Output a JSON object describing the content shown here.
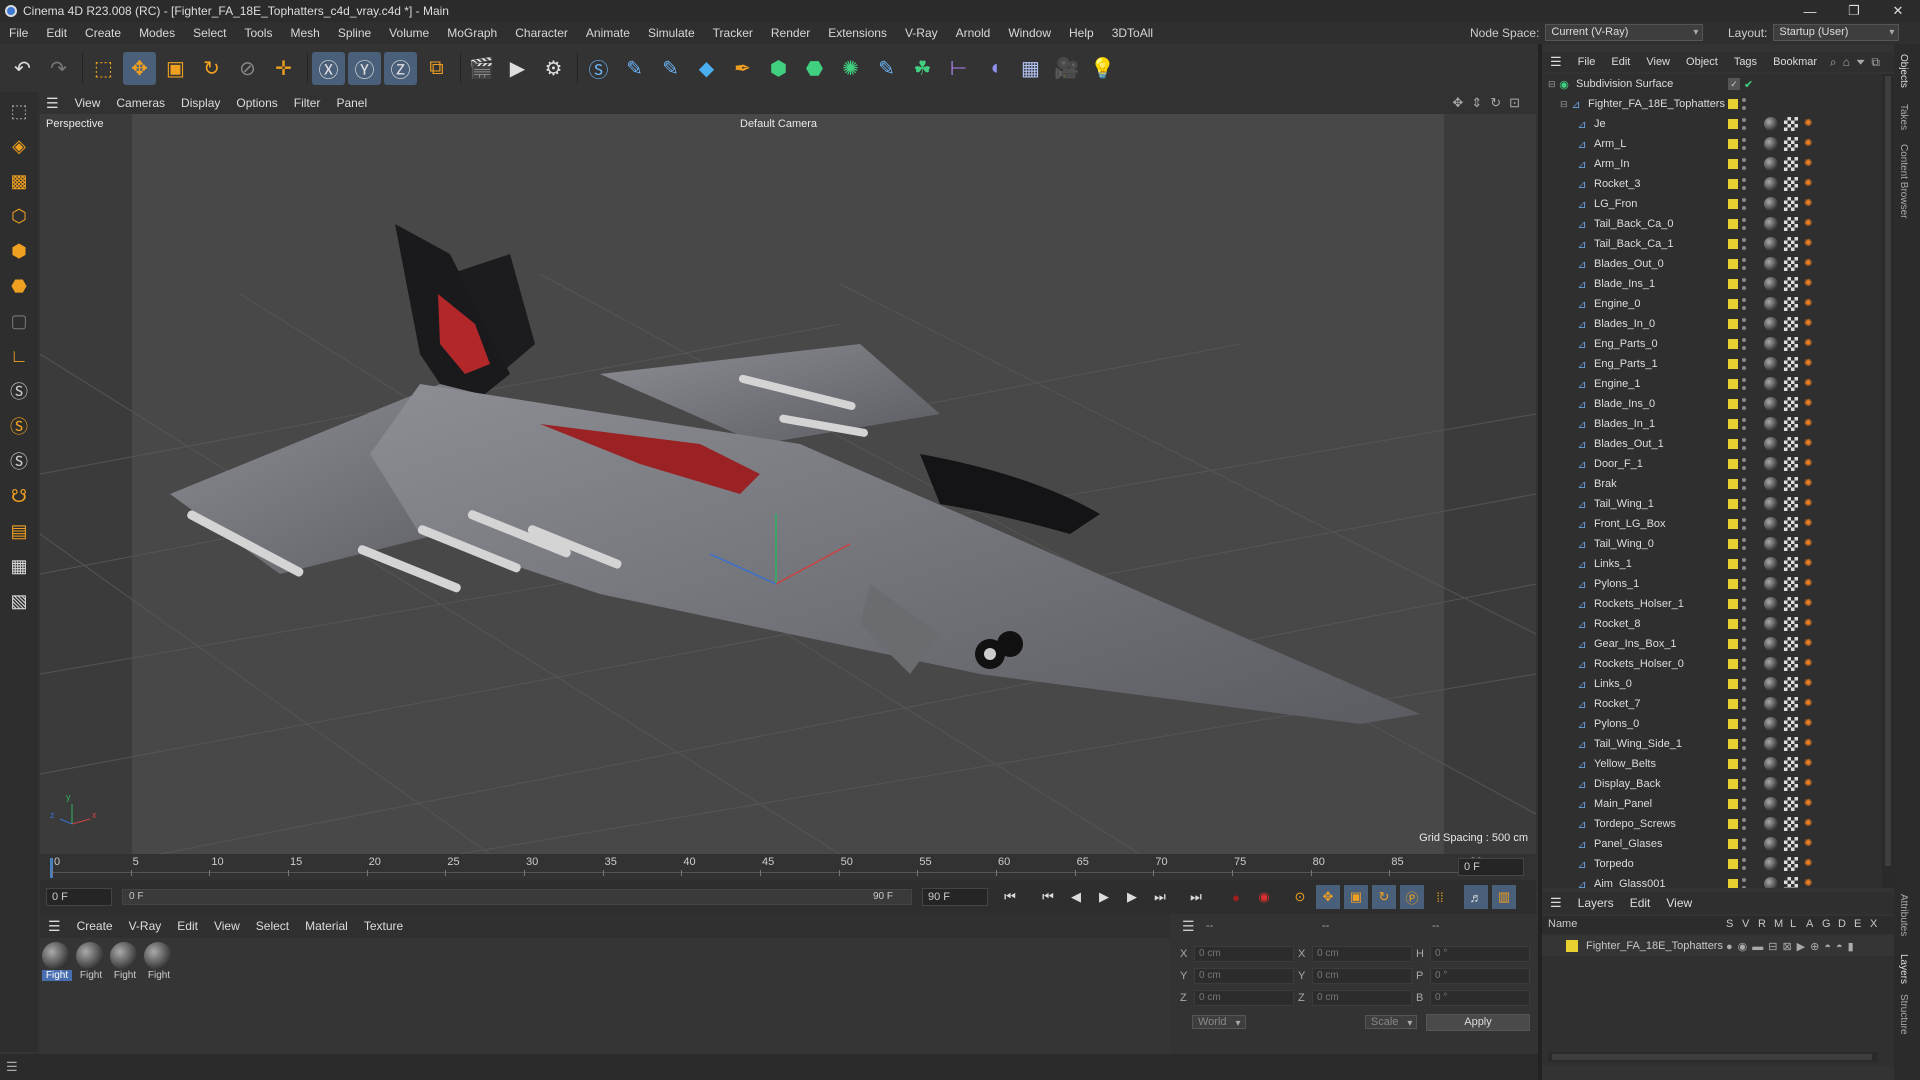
{
  "window": {
    "title": "Cinema 4D R23.008 (RC) - [Fighter_FA_18E_Tophatters_c4d_vray.c4d *] - Main",
    "controls": [
      "—",
      "❐",
      "✕"
    ]
  },
  "menubar": [
    "File",
    "Edit",
    "Create",
    "Modes",
    "Select",
    "Tools",
    "Mesh",
    "Spline",
    "Volume",
    "MoGraph",
    "Character",
    "Animate",
    "Simulate",
    "Tracker",
    "Render",
    "Extensions",
    "V-Ray",
    "Arnold",
    "Window",
    "Help",
    "3DToAll"
  ],
  "node_space": {
    "label": "Node Space:",
    "value": "Current (V-Ray)"
  },
  "layout": {
    "label": "Layout:",
    "value": "Startup (User)"
  },
  "viewport": {
    "menu": [
      "View",
      "Cameras",
      "Display",
      "Options",
      "Filter",
      "Panel"
    ],
    "view_name": "Perspective",
    "camera": "Default Camera",
    "grid_spacing": "Grid Spacing : 500 cm",
    "axis": {
      "x": "x",
      "y": "y",
      "z": "z"
    }
  },
  "timeline": {
    "ticks": [
      "0",
      "5",
      "10",
      "15",
      "20",
      "25",
      "30",
      "35",
      "40",
      "45",
      "50",
      "55",
      "60",
      "65",
      "70",
      "75",
      "80",
      "85",
      "90"
    ],
    "current": "0 F"
  },
  "time_controls": {
    "start": "0 F",
    "range_start": "0 F",
    "range_end": "90 F",
    "end": "90 F"
  },
  "material_manager": {
    "menu": [
      "Create",
      "V-Ray",
      "Edit",
      "View",
      "Select",
      "Material",
      "Texture"
    ],
    "materials": [
      "Fight",
      "Fight",
      "Fight",
      "Fight"
    ]
  },
  "coordinates": {
    "header": "--",
    "header2": "--",
    "header3": "--",
    "rows": [
      {
        "a": "X",
        "av": "0 cm",
        "b": "X",
        "bv": "0 cm",
        "c": "H",
        "cv": "0 °"
      },
      {
        "a": "Y",
        "av": "0 cm",
        "b": "Y",
        "bv": "0 cm",
        "c": "P",
        "cv": "0 °"
      },
      {
        "a": "Z",
        "av": "0 cm",
        "b": "Z",
        "bv": "0 cm",
        "c": "B",
        "cv": "0 °"
      }
    ],
    "mode": "World",
    "mode2": "Scale",
    "apply": "Apply"
  },
  "object_manager": {
    "menu": [
      "File",
      "Edit",
      "View",
      "Object",
      "Tags",
      "Bookmar"
    ],
    "root": "Subdivision Surface",
    "group": "Fighter_FA_18E_Tophatters",
    "objects": [
      "Je",
      "Arm_L",
      "Arm_In",
      "Rocket_3",
      "LG_Fron",
      "Tail_Back_Ca_0",
      "Tail_Back_Ca_1",
      "Blades_Out_0",
      "Blade_Ins_1",
      "Engine_0",
      "Blades_In_0",
      "Eng_Parts_0",
      "Eng_Parts_1",
      "Engine_1",
      "Blade_Ins_0",
      "Blades_In_1",
      "Blades_Out_1",
      "Door_F_1",
      "Brak",
      "Tail_Wing_1",
      "Front_LG_Box",
      "Tail_Wing_0",
      "Links_1",
      "Pylons_1",
      "Rockets_Holser_1",
      "Rocket_8",
      "Gear_Ins_Box_1",
      "Rockets_Holser_0",
      "Links_0",
      "Rocket_7",
      "Pylons_0",
      "Tail_Wing_Side_1",
      "Yellow_Belts",
      "Display_Back",
      "Main_Panel",
      "Tordepo_Screws",
      "Panel_Glases",
      "Torpedo",
      "Aim_Glass001"
    ]
  },
  "right_tabs": [
    "Objects",
    "Takes",
    "Content Browser",
    "Attributes",
    "Layers",
    "Structure"
  ],
  "layers": {
    "menu": [
      "Layers",
      "Edit",
      "View"
    ],
    "columns": [
      "Name",
      "S",
      "V",
      "R",
      "M",
      "L",
      "A",
      "G",
      "D",
      "E",
      "X"
    ],
    "row": "Fighter_FA_18E_Tophatters"
  },
  "colors": {
    "accent": "#4a5f7a",
    "layer": "#e8d030",
    "bg": "#333333"
  }
}
